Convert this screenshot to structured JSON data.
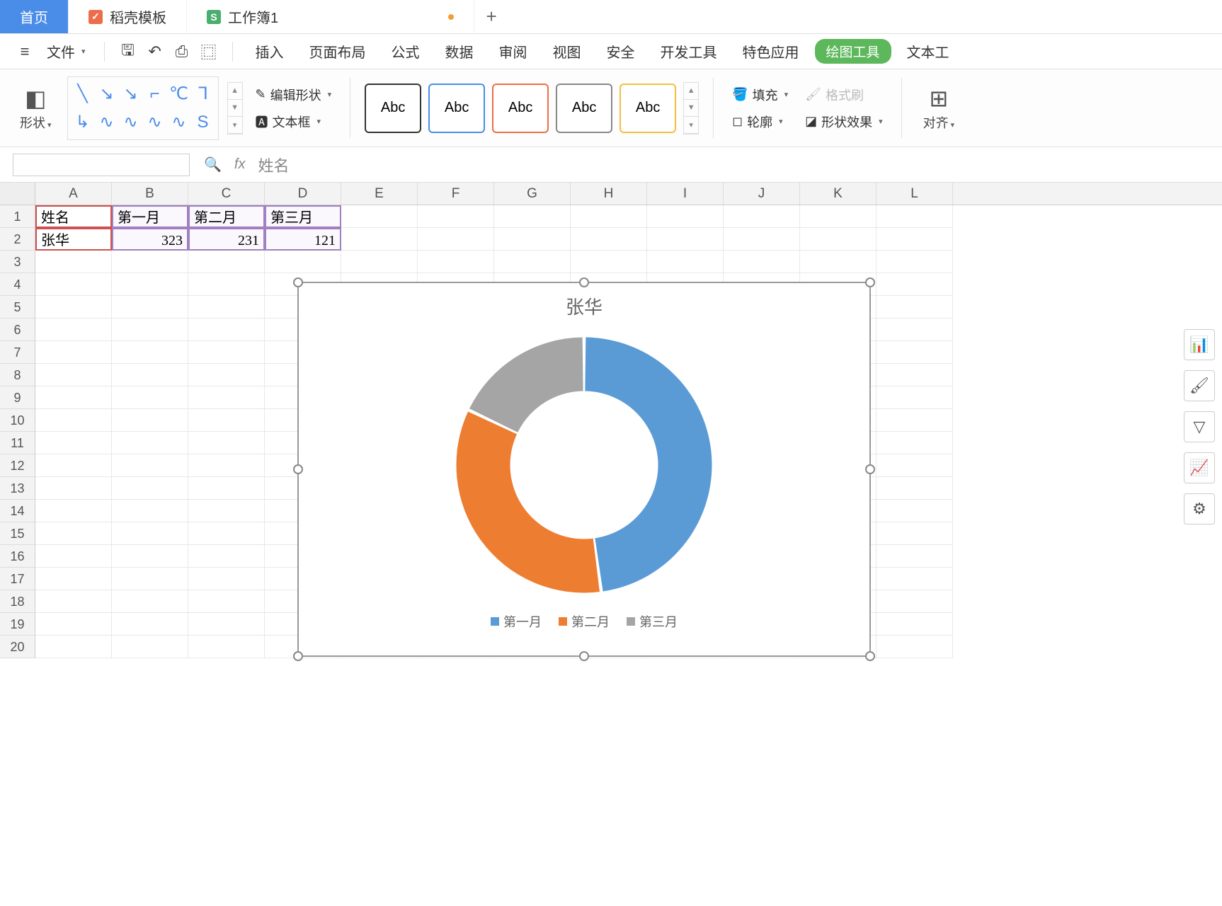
{
  "tabs": {
    "home": "首页",
    "docer": "稻壳模板",
    "workbook": "工作簿1"
  },
  "menu": {
    "file": "文件",
    "insert": "插入",
    "page_layout": "页面布局",
    "formula": "公式",
    "data": "数据",
    "review": "审阅",
    "view": "视图",
    "security": "安全",
    "dev_tools": "开发工具",
    "special": "特色应用",
    "drawing_tools": "绘图工具",
    "text_tools": "文本工"
  },
  "ribbon": {
    "shape": "形状",
    "edit_shape": "编辑形状",
    "text_box": "文本框",
    "abc": "Abc",
    "fill": "填充",
    "format_painter": "格式刷",
    "outline": "轮廓",
    "shape_effects": "形状效果",
    "align": "对齐"
  },
  "formula_bar": {
    "fx": "fx",
    "value": "姓名"
  },
  "columns": [
    "A",
    "B",
    "C",
    "D",
    "E",
    "F",
    "G",
    "H",
    "I",
    "J",
    "K",
    "L"
  ],
  "sheet": {
    "headers": [
      "姓名",
      "第一月",
      "第二月",
      "第三月"
    ],
    "row_name": "张华",
    "values": [
      323,
      231,
      121
    ]
  },
  "chart_data": {
    "type": "pie",
    "title": "张华",
    "categories": [
      "第一月",
      "第二月",
      "第三月"
    ],
    "values": [
      323,
      231,
      121
    ],
    "colors": [
      "#5b9bd5",
      "#ed7d31",
      "#a5a5a5"
    ],
    "legend_position": "bottom",
    "donut": true
  }
}
